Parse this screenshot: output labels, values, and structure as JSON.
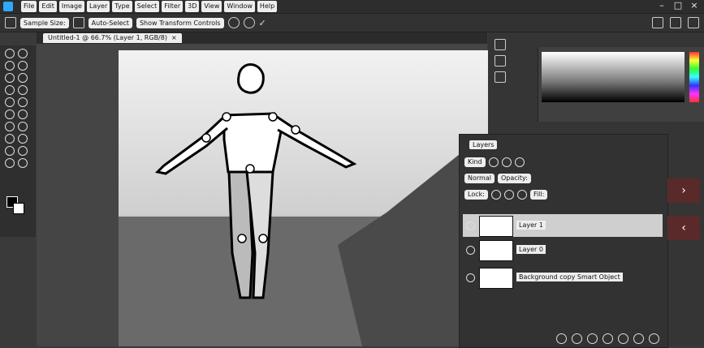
{
  "menubar": {
    "items": [
      "File",
      "Edit",
      "Image",
      "Layer",
      "Type",
      "Select",
      "Filter",
      "3D",
      "View",
      "Window",
      "Help"
    ]
  },
  "optionsbar": {
    "buttons": [
      "Sample Size:",
      "Auto-Select",
      "Show Transform Controls"
    ]
  },
  "document": {
    "tab_label": "Untitled-1 @ 66.7% (Layer 1, RGB/8)",
    "close_glyph": "×"
  },
  "layers_panel": {
    "title": "Layers",
    "kind_label": "Kind",
    "blend_mode": "Normal",
    "opacity_label": "Opacity:",
    "lock_label": "Lock:",
    "fill_label": "Fill:",
    "layers": [
      {
        "name": "Layer 1",
        "thumb": "transform-icon"
      },
      {
        "name": "Layer 0",
        "thumb": "empty-mask-icon"
      },
      {
        "name": "Background copy Smart Object",
        "thumb": "image-thumb"
      }
    ]
  },
  "colors": {
    "accent": "#31a8ff",
    "side_button": "#5a2a2a"
  }
}
